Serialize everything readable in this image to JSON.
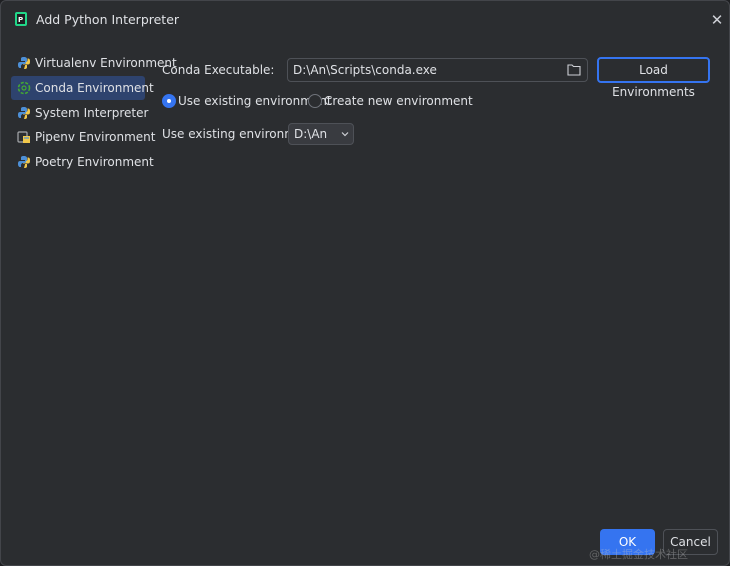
{
  "window": {
    "title": "Add Python Interpreter",
    "close_glyph": "✕"
  },
  "sidebar": {
    "items": [
      {
        "label": "Virtualenv Environment",
        "icon": "virtualenv-icon",
        "selected": false
      },
      {
        "label": "Conda Environment",
        "icon": "conda-icon",
        "selected": true
      },
      {
        "label": "System Interpreter",
        "icon": "python-icon",
        "selected": false
      },
      {
        "label": "Pipenv Environment",
        "icon": "pipenv-icon",
        "selected": false
      },
      {
        "label": "Poetry Environment",
        "icon": "poetry-icon",
        "selected": false
      }
    ]
  },
  "form": {
    "executable_label": "Conda Executable:",
    "executable_value": "D:\\An\\Scripts\\conda.exe",
    "load_button": "Load Environments",
    "radio_use_existing": "Use existing environment",
    "radio_create_new": "Create new environment",
    "selected_radio": "use_existing",
    "existing_env_label": "Use existing environment:",
    "existing_env_value": "D:\\An"
  },
  "footer": {
    "ok_label": "OK",
    "cancel_label": "Cancel"
  },
  "watermark": "@稀土掘金技术社区",
  "colors": {
    "accent": "#3574f0",
    "background": "#2b2d30",
    "selection": "#2e436e"
  }
}
